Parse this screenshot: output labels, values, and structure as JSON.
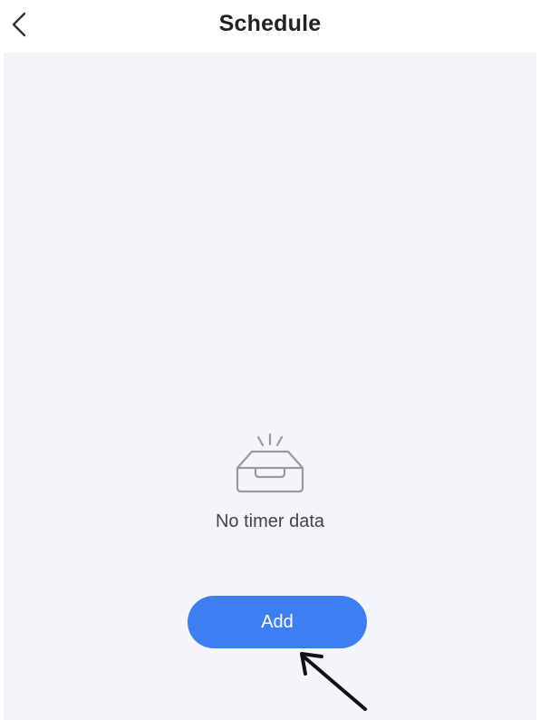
{
  "header": {
    "title": "Schedule",
    "back_icon": "chevron-left-icon"
  },
  "empty_state": {
    "icon": "empty-inbox-icon",
    "message": "No timer data"
  },
  "actions": {
    "add_label": "Add"
  },
  "colors": {
    "accent": "#3d7ef2",
    "content_background": "#f4f5fa",
    "title_text": "#222222",
    "secondary_text": "#444444",
    "icon_stroke": "#9a9a9a"
  },
  "annotation": {
    "icon": "pointer-arrow-icon"
  }
}
